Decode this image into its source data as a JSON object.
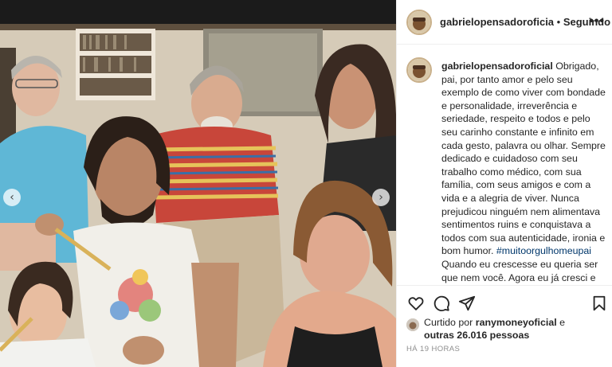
{
  "post": {
    "username": "gabrielopensadoroficia",
    "dot": " • ",
    "follow_status": "Seguindo",
    "more_label": "•••"
  },
  "photo": {
    "prev_arrow": "‹",
    "next_arrow": "›"
  },
  "caption": {
    "username": "gabrielopensadoroficial",
    "text_before_hashtag": " Obrigado, pai, por tanto amor e pelo seu exemplo de como viver com bondade e personalidade, irreverência e seriedade, respeito e todos e pelo seu carinho constante e infinito em cada gesto, palavra ou olhar. Sempre dedicado e cuidadoso com seu trabalho como médico, com sua família, com seus amigos e com a vida e a alegria de viver. Nunca prejudicou ninguém nem alimentava sentimentos ruins e conquistava a todos com sua autenticidade, ironia e bom humor.",
    "hashtag": "#muitoorgulhomeupai",
    "text_after_hashtag": " Quando eu crescesse eu queria ser que nem você. Agora eu já cresci e ainda quero ser! Descanse em paz, com a sua liberdade de volta, depois de nos dar mais uma"
  },
  "actions": {
    "like_icon": "heart-icon",
    "comment_icon": "comment-icon",
    "share_icon": "paper-plane-icon",
    "save_icon": "bookmark-icon"
  },
  "likes": {
    "prefix": "Curtido por ",
    "user": "ranymoneyoficial",
    "connector": " e",
    "others": "outras 26.016 pessoas"
  },
  "timestamp": "HÁ 19 HORAS",
  "colors": {
    "text": "#262626",
    "secondary": "#8e8e8e",
    "hashtag": "#00376b",
    "border": "#efefef"
  }
}
